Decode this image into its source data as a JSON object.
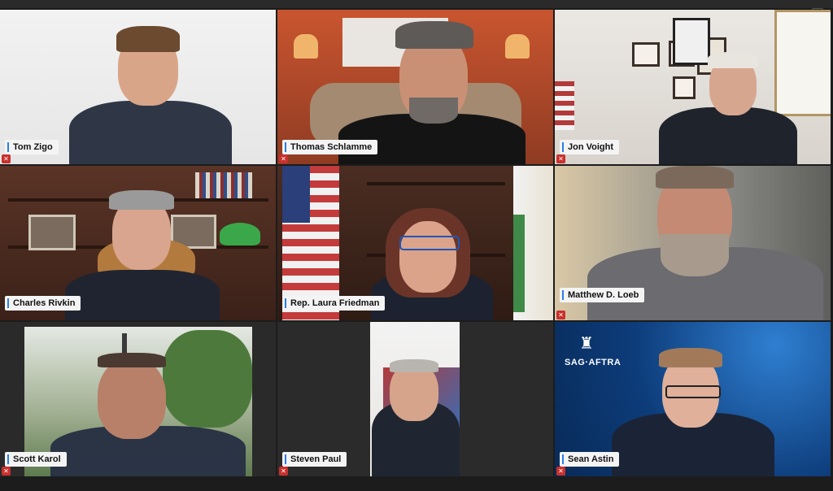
{
  "meeting": {
    "participants": [
      {
        "name": "Tom Zigo",
        "muted": true
      },
      {
        "name": "Thomas Schlamme",
        "muted": true
      },
      {
        "name": "Jon Voight",
        "muted": true
      },
      {
        "name": "Charles Rivkin",
        "muted": false
      },
      {
        "name": "Rep. Laura Friedman",
        "muted": false
      },
      {
        "name": "Matthew D. Loeb",
        "muted": true
      },
      {
        "name": "Scott Karol",
        "muted": true
      },
      {
        "name": "Steven Paul",
        "muted": true
      },
      {
        "name": "Sean Astin",
        "muted": true
      }
    ],
    "muted_icon": "muted-mic-icon",
    "sag_aftra_logo": "SAG·AFTRA"
  },
  "colors": {
    "active_speaker": "#3fae4a",
    "name_accent": "#2b7de9",
    "muted": "#c9302c"
  }
}
